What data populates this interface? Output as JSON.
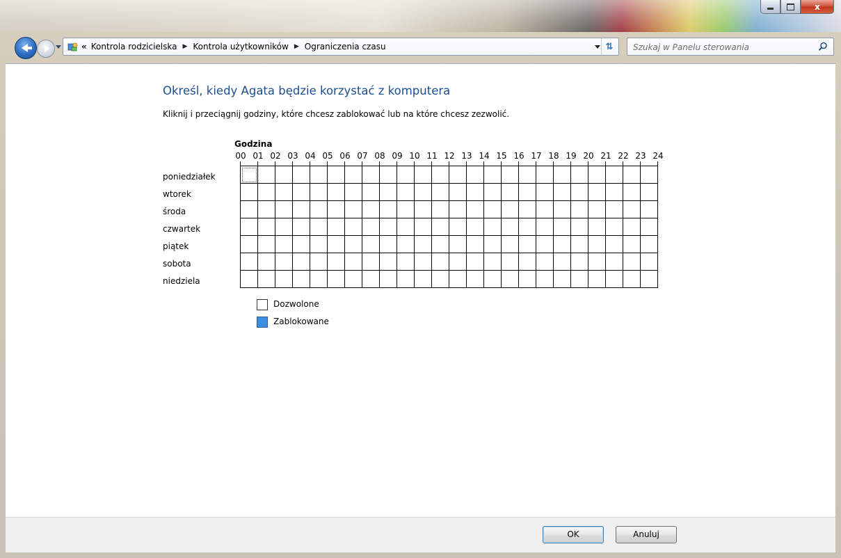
{
  "window": {
    "minimize_label": "–",
    "maximize_label": "□",
    "close_label": "x"
  },
  "nav": {
    "back_icon": "back-arrow-icon",
    "forward_icon": "forward-arrow-icon",
    "breadcrumb_overflow": "«",
    "breadcrumbs": [
      "Kontrola rodzicielska",
      "Kontrola użytkowników",
      "Ograniczenia czasu"
    ],
    "search_placeholder": "Szukaj w Panelu sterowania"
  },
  "main": {
    "heading": "Określ, kiedy Agata będzie korzystać z komputera",
    "instruction": "Kliknij i przeciągnij godziny, które chcesz zablokować lub na które chcesz zezwolić.",
    "hour_header": "Godzina",
    "hours": [
      "00",
      "01",
      "02",
      "03",
      "04",
      "05",
      "06",
      "07",
      "08",
      "09",
      "10",
      "11",
      "12",
      "13",
      "14",
      "15",
      "16",
      "17",
      "18",
      "19",
      "20",
      "21",
      "22",
      "23",
      "24"
    ],
    "days": [
      "poniedziałek",
      "wtorek",
      "środa",
      "czwartek",
      "piątek",
      "sobota",
      "niedziela"
    ],
    "blocked_cells": [],
    "legend": {
      "allowed_label": "Dozwolone",
      "blocked_label": "Zablokowane",
      "allowed_color": "#ffffff",
      "blocked_color": "#3b8fe0"
    }
  },
  "footer": {
    "ok_label": "OK",
    "cancel_label": "Anuluj"
  }
}
